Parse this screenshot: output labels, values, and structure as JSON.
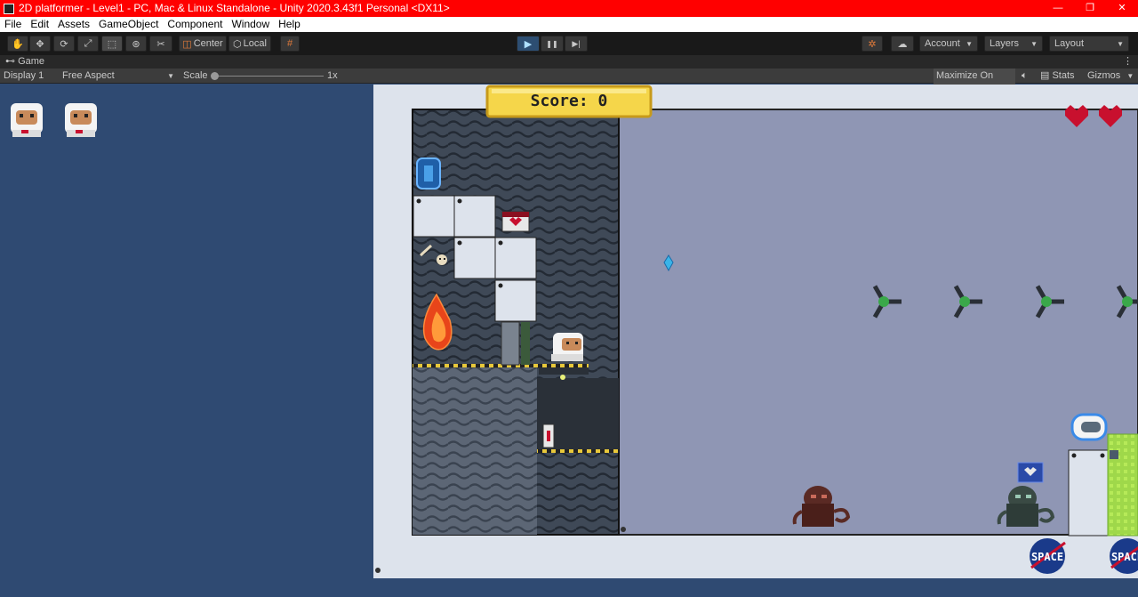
{
  "window": {
    "title": "2D platformer - Level1 - PC, Mac & Linux Standalone - Unity 2020.3.43f1 Personal <DX11>",
    "minimize_glyph": "—",
    "maximize_glyph": "❐",
    "close_glyph": "✕"
  },
  "menu": {
    "items": [
      "File",
      "Edit",
      "Assets",
      "GameObject",
      "Component",
      "Window",
      "Help"
    ]
  },
  "toolbar": {
    "tools": [
      "hand-tool-icon",
      "move-tool-icon",
      "rotate-tool-icon",
      "scale-tool-icon",
      "rect-tool-icon",
      "transform-tool-icon",
      "custom-tool-icon"
    ],
    "active_tool_index": 4,
    "center_label": "Center",
    "local_label": "Local",
    "play_glyph": "▶",
    "pause_glyph": "❚❚",
    "step_glyph": "▶|",
    "account_label": "Account",
    "layers_label": "Layers",
    "layout_label": "Layout"
  },
  "tab": {
    "label": "Game"
  },
  "game_bar": {
    "display_label": "Display 1",
    "aspect_label": "Free Aspect",
    "scale_label": "Scale",
    "scale_value": "1x",
    "maximize_label": "Maximize On Play",
    "stats_label": "Stats",
    "gizmos_label": "Gizmos"
  },
  "game": {
    "score_text": "Score: 0",
    "lives_remaining": 2,
    "hearts": 2,
    "space_logo_text": "SPACE",
    "colors": {
      "background_blue": "#2f4a72",
      "sky": "#8f96b4",
      "score_panel": "#f5d64a",
      "heart": "#c8102e"
    }
  }
}
